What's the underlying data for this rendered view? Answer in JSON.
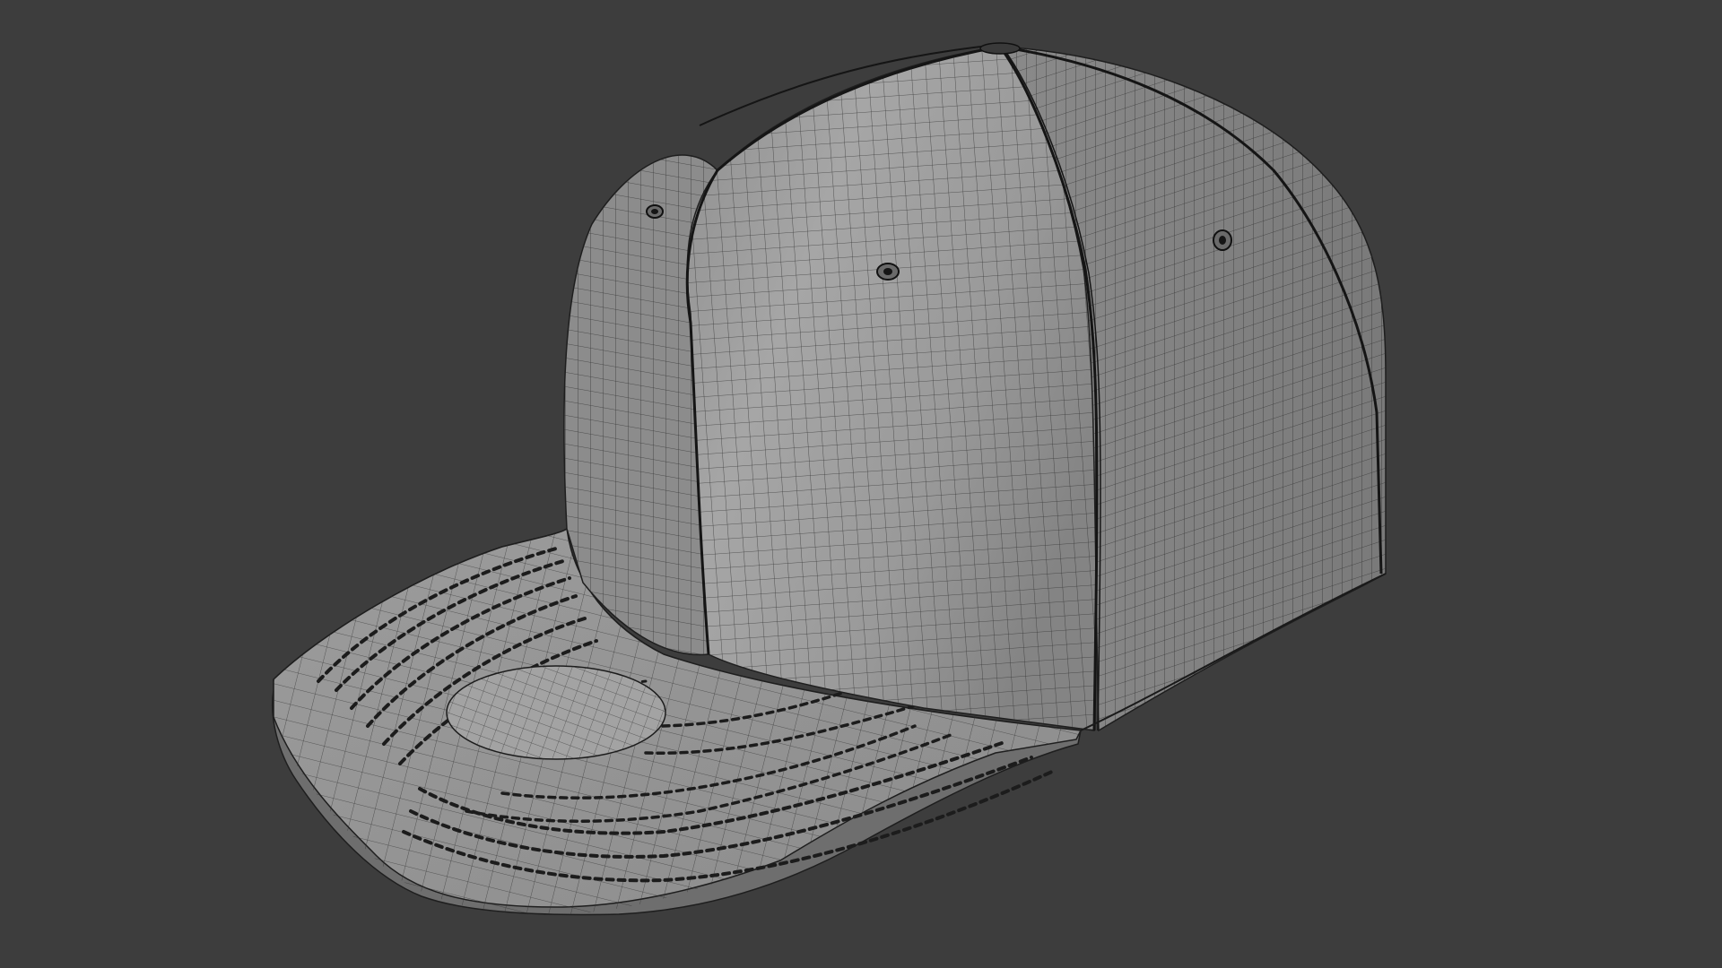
{
  "viewport": {
    "background_color": "#3d3d3d",
    "shading": "solid",
    "overlay": "wireframe"
  },
  "model": {
    "object": "snapback-cap",
    "surface_color": "#9a9a9a",
    "wire_color": "#1a1a1a",
    "eyelets": 3,
    "crown_panels": 6,
    "brim_stitch_rows": 8
  }
}
